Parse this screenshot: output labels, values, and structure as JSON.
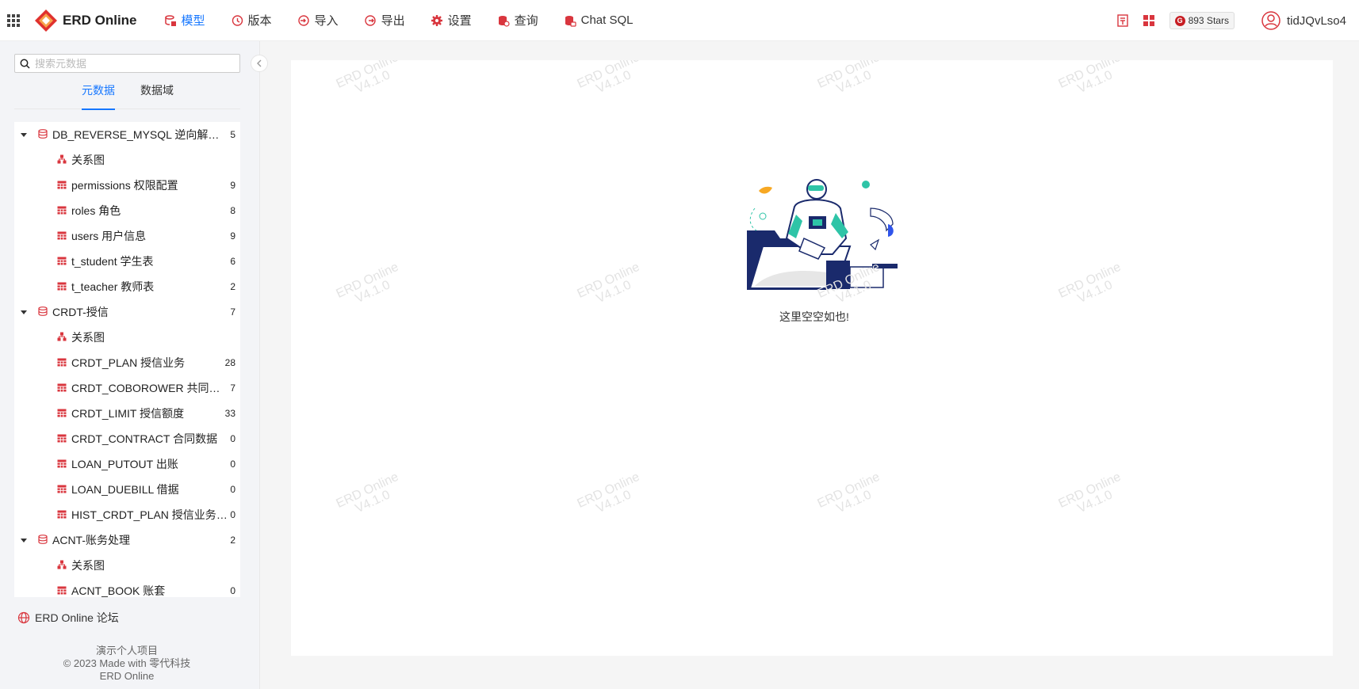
{
  "app": {
    "name": "ERD Online"
  },
  "nav": {
    "items": [
      {
        "label": "模型",
        "icon": "model-icon",
        "active": true
      },
      {
        "label": "版本",
        "icon": "history-icon"
      },
      {
        "label": "导入",
        "icon": "import-icon"
      },
      {
        "label": "导出",
        "icon": "export-icon"
      },
      {
        "label": "设置",
        "icon": "gear-icon"
      },
      {
        "label": "查询",
        "icon": "database-query-icon"
      },
      {
        "label": "Chat SQL",
        "icon": "chat-sql-icon"
      }
    ]
  },
  "header": {
    "stars": "893 Stars",
    "username": "tidJQvLso4"
  },
  "sidebar": {
    "search_placeholder": "搜索元数据",
    "tabs": [
      "元数据",
      "数据域"
    ],
    "tree": [
      {
        "type": "db",
        "label": "DB_REVERSE_MYSQL 逆向解析的数据库",
        "count": "5"
      },
      {
        "type": "graph",
        "label": "关系图"
      },
      {
        "type": "table",
        "label": "permissions 权限配置",
        "count": "9"
      },
      {
        "type": "table",
        "label": "roles 角色",
        "count": "8"
      },
      {
        "type": "table",
        "label": "users 用户信息",
        "count": "9"
      },
      {
        "type": "table",
        "label": "t_student 学生表",
        "count": "6"
      },
      {
        "type": "table",
        "label": "t_teacher 教师表",
        "count": "2"
      },
      {
        "type": "db",
        "label": "CRDT-授信",
        "count": "7"
      },
      {
        "type": "graph",
        "label": "关系图"
      },
      {
        "type": "table",
        "label": "CRDT_PLAN 授信业务",
        "count": "28"
      },
      {
        "type": "table",
        "label": "CRDT_COBOROWER 共同借款人",
        "count": "7"
      },
      {
        "type": "table",
        "label": "CRDT_LIMIT 授信额度",
        "count": "33"
      },
      {
        "type": "table",
        "label": "CRDT_CONTRACT 合同数据",
        "count": "0"
      },
      {
        "type": "table",
        "label": "LOAN_PUTOUT 出账",
        "count": "0"
      },
      {
        "type": "table",
        "label": "LOAN_DUEBILL 借据",
        "count": "0"
      },
      {
        "type": "table",
        "label": "HIST_CRDT_PLAN 授信业务历史",
        "count": "0"
      },
      {
        "type": "db",
        "label": "ACNT-账务处理",
        "count": "2"
      },
      {
        "type": "graph",
        "label": "关系图"
      },
      {
        "type": "table",
        "label": "ACNT_BOOK 账套",
        "count": "0"
      }
    ],
    "forum_label": "ERD Online 论坛",
    "footer": [
      "演示个人项目",
      "© 2023 Made with 零代科技",
      "ERD Online"
    ]
  },
  "main": {
    "empty_text": "这里空空如也!",
    "watermark": [
      "ERD Online",
      "V4.1.0"
    ]
  },
  "colors": {
    "accent": "#1677ff",
    "brand": "#e0312e",
    "icon_red": "#d9363e"
  }
}
